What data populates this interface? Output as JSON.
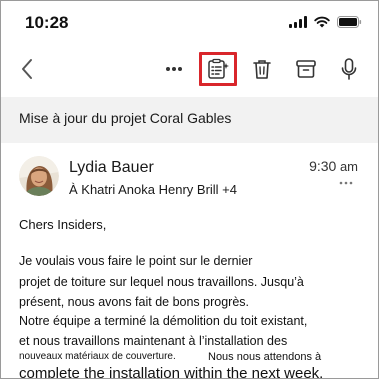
{
  "status_bar": {
    "time": "10:28"
  },
  "toolbar": {
    "icons": [
      "chevron-left-icon",
      "more-horizontal-icon",
      "summarize-icon",
      "trash-icon",
      "archive-icon",
      "microphone-icon"
    ],
    "highlight_color": "#d9262b"
  },
  "email": {
    "subject": "Mise à jour du projet Coral Gables",
    "sender_name": "Lydia Bauer",
    "recipients": "À Khatri Anoka Henry Brill +4",
    "time": "9:30",
    "time_suffix": "am",
    "body": {
      "greeting": "Chers Insiders,",
      "line1": "Je voulais vous faire le point sur le dernier",
      "line2": "projet de toiture sur lequel nous travaillons. Jusqu’à",
      "line3": "présent, nous avons fait de bons progrès.",
      "line4": "Notre équipe a terminé la démolition du toit existant,",
      "line5": "et nous travaillons maintenant à l’installation des",
      "line6a": "nouveaux matériaux de couverture.",
      "line6b": "Nous nous attendons à",
      "line7": "complete the installation within the next week."
    }
  }
}
